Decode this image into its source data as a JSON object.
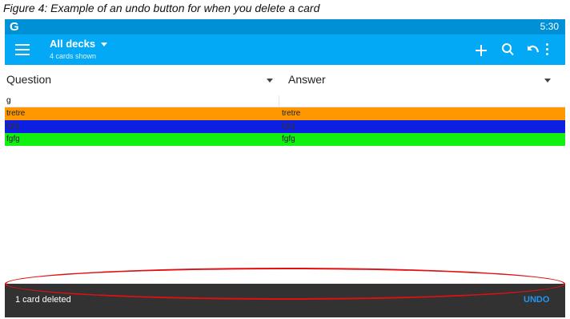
{
  "caption": "Figure 4: Example of an undo button for when you delete a card",
  "status_bar": {
    "app_glyph": "G",
    "time": "5:30"
  },
  "toolbar": {
    "deck_title": "All decks",
    "subtitle": "4 cards shown",
    "icons": [
      "menu-icon",
      "add-icon",
      "search-icon",
      "undo-icon",
      "more-vert-icon"
    ]
  },
  "columns": {
    "question_label": "Question",
    "answer_label": "Answer"
  },
  "rows": [
    {
      "question": "g",
      "answer": "",
      "color": "#ffffff"
    },
    {
      "question": "tretre",
      "answer": "tretre",
      "color": "#ff9800"
    },
    {
      "question": "fgfg",
      "answer": "fgfg",
      "color": "#0d1fe2"
    },
    {
      "question": "fgfg",
      "answer": "fgfg",
      "color": "#11f011"
    }
  ],
  "snackbar": {
    "message": "1 card deleted",
    "action_label": "UNDO"
  },
  "colors": {
    "status_bar": "#0090d6",
    "toolbar": "#03a9f4",
    "snackbar": "#323232",
    "action": "#2196f3",
    "highlight": "#e01010"
  }
}
